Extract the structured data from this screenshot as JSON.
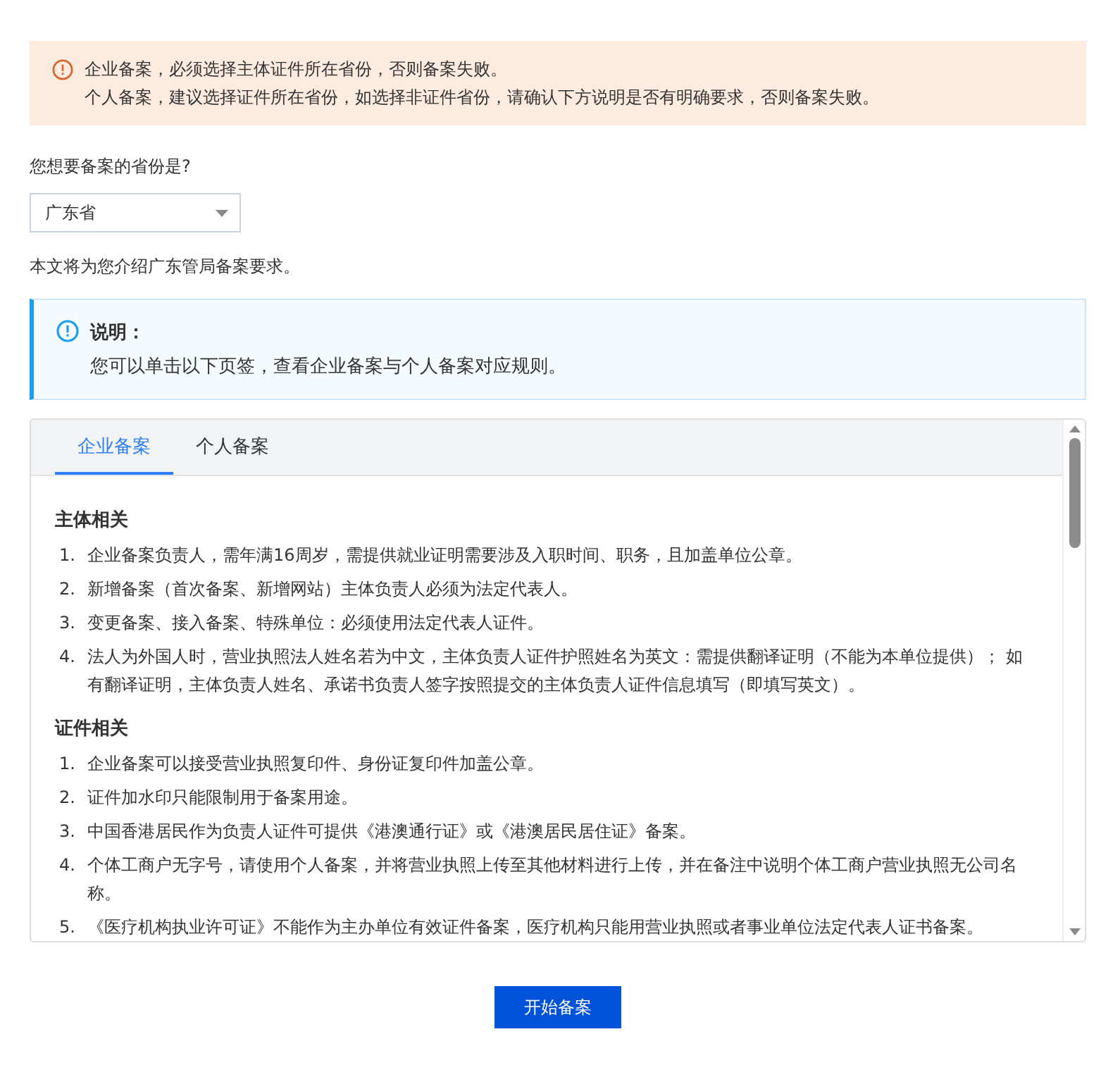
{
  "warning": {
    "lines": [
      "企业备案，必须选择主体证件所在省份，否则备案失败。",
      "个人备案，建议选择证件所在省份，如选择非证件省份，请确认下方说明是否有明确要求，否则备案失败。"
    ]
  },
  "province_question": "您想要备案的省份是?",
  "province_select": {
    "value": "广东省"
  },
  "intro": "本文将为您介绍广东管局备案要求。",
  "note": {
    "title": "说明：",
    "text": "您可以单击以下页签，查看企业备案与个人备案对应规则。"
  },
  "tabs": [
    {
      "label": "企业备案",
      "selected": true
    },
    {
      "label": "个人备案",
      "selected": false
    }
  ],
  "sections": [
    {
      "heading": "主体相关",
      "items": [
        {
          "number": "1.",
          "text": "企业备案负责人，需年满16周岁，需提供就业证明需要涉及入职时间、职务，且加盖单位公章。"
        },
        {
          "number": "2.",
          "text": "新增备案（首次备案、新增网站）主体负责人必须为法定代表人。"
        },
        {
          "number": "3.",
          "text": "变更备案、接入备案、特殊单位：必须使用法定代表人证件。"
        },
        {
          "number": "4.",
          "text": "法人为外国人时，营业执照法人姓名若为中文，主体负责人证件护照姓名为英文：需提供翻译证明（不能为本单位提供）； 如有翻译证明，主体负责人姓名、承诺书负责人签字按照提交的主体负责人证件信息填写（即填写英文）。"
        }
      ]
    },
    {
      "heading": "证件相关",
      "items": [
        {
          "number": "1.",
          "text": "企业备案可以接受营业执照复印件、身份证复印件加盖公章。"
        },
        {
          "number": "2.",
          "text": "证件加水印只能限制用于备案用途。"
        },
        {
          "number": "3.",
          "text": "中国香港居民作为负责人证件可提供《港澳通行证》或《港澳居民居住证》备案。"
        },
        {
          "number": "4.",
          "text": "个体工商户无字号，请使用个人备案，并将营业执照上传至其他材料进行上传，并在备注中说明个体工商户营业执照无公司名称。"
        },
        {
          "number": "5.",
          "text": "《医疗机构执业许可证》不能作为主办单位有效证件备案，医疗机构只能用营业执照或者事业单位法定代表人证书备案。"
        }
      ]
    }
  ],
  "start_button": "开始备案"
}
